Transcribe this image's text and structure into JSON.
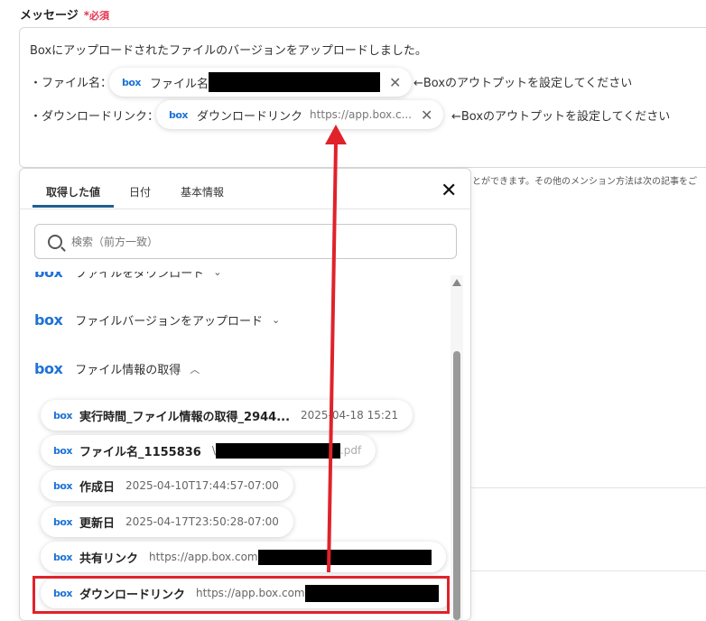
{
  "field": {
    "label": "メッセージ",
    "required_star": "*",
    "required_text": "必須"
  },
  "message": {
    "line1": "Boxにアップロードされたファイルのバージョンをアップロードしました。",
    "line2_prefix": "・ファイル名：",
    "line3_prefix": "・ダウンロードリンク：",
    "chip1": {
      "logo": "box",
      "label": "ファイル名",
      "close": "✕"
    },
    "chip2": {
      "logo": "box",
      "label": "ダウンロードリンク",
      "url": "https://app.box.c...",
      "close": "✕"
    },
    "hint": "←Boxのアウトプットを設定してください"
  },
  "side_hint": "とができます。その他のメンション方法は次の記事をご",
  "popup": {
    "tabs": [
      {
        "label": "取得した値",
        "active": true
      },
      {
        "label": "日付"
      },
      {
        "label": "基本情報"
      }
    ],
    "close": "✕",
    "search_placeholder": "検索（前方一致）",
    "groups": [
      {
        "logo": "box",
        "label": "ファイルをダウンロード",
        "chevron": "⌄"
      },
      {
        "logo": "box",
        "label": "ファイルバージョンをアップロード",
        "chevron": "⌄"
      },
      {
        "logo": "box",
        "label": "ファイル情報の取得",
        "chevron": "︿"
      }
    ],
    "items": [
      {
        "label": "実行時間_ファイル情報の取得_2944...",
        "value": "2025-04-18 15:21"
      },
      {
        "label": "ファイル名_1155836",
        "value_prefix": "\\",
        "value_suffix": ".pdf"
      },
      {
        "label": "作成日",
        "value": "2025-04-10T17:44:57-07:00"
      },
      {
        "label": "更新日",
        "value": "2025-04-17T23:50:28-07:00"
      },
      {
        "label": "共有リンク",
        "value": "https://app.box.com"
      },
      {
        "label": "ダウンロードリンク",
        "value": "https://app.box.com"
      }
    ]
  },
  "colors": {
    "brand": "#1d72d6",
    "required": "#e6334e",
    "tab_accent": "#1f5f92",
    "highlight": "#e0222a"
  }
}
